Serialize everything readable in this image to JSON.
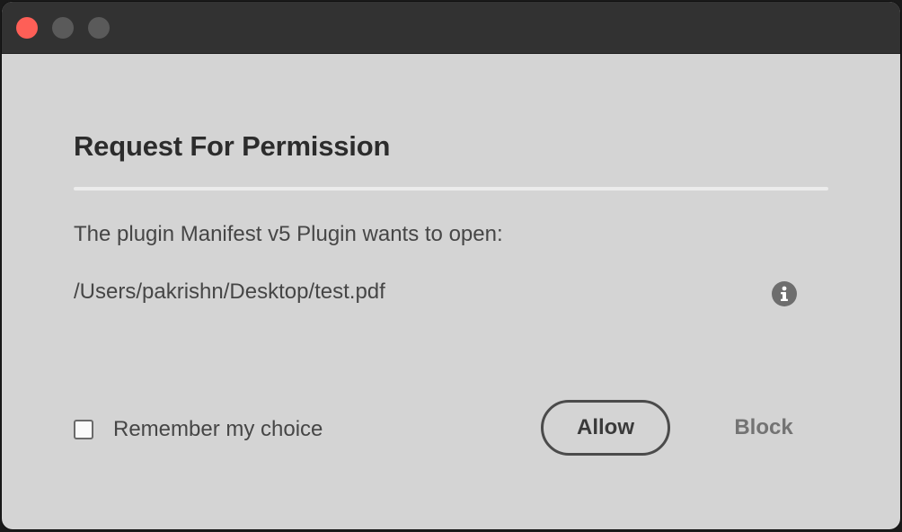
{
  "window": {
    "controls": {
      "close_color": "#fe5f57",
      "minimize_color": "#5a5a5a",
      "zoom_color": "#5a5a5a"
    }
  },
  "dialog": {
    "title": "Request For Permission",
    "message": "The plugin Manifest v5 Plugin wants to open:",
    "path": "/Users/pakrishn/Desktop/test.pdf",
    "info_icon": "info-icon",
    "remember_label": "Remember my choice",
    "remember_checked": false,
    "allow_label": "Allow",
    "block_label": "Block"
  }
}
